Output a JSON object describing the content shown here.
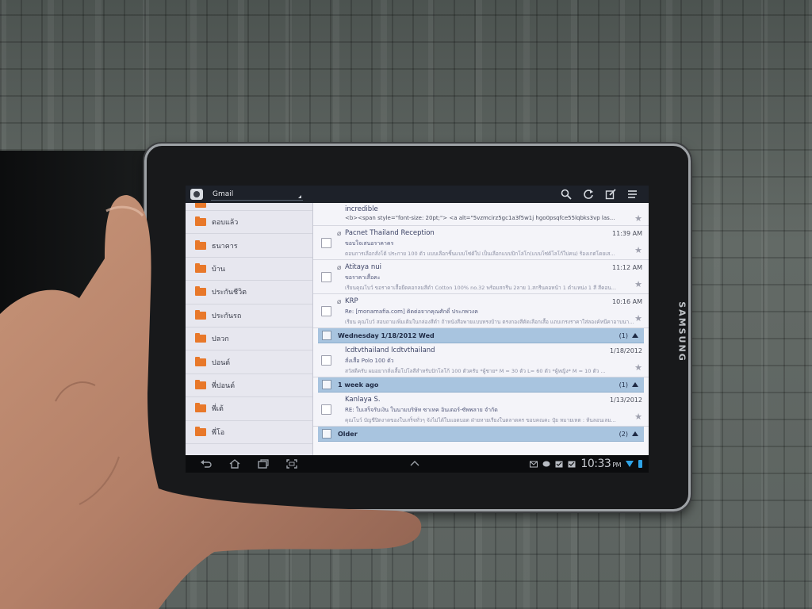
{
  "device": {
    "brand": "SAMSUNG"
  },
  "actionbar": {
    "account_label": "Gmail",
    "icons": [
      "search-icon",
      "refresh-icon",
      "compose-icon",
      "menu-icon"
    ]
  },
  "sidebar": {
    "items": [
      {
        "label": ""
      },
      {
        "label": "ตอบแล้ว"
      },
      {
        "label": "ธนาคาร"
      },
      {
        "label": "บ้าน"
      },
      {
        "label": "ประกันชีวิต"
      },
      {
        "label": "ประกันรถ"
      },
      {
        "label": "ปลวก"
      },
      {
        "label": "ปอนด์"
      },
      {
        "label": "พี่ปอนด์"
      },
      {
        "label": "พี่เต้"
      },
      {
        "label": "พี่โอ"
      }
    ]
  },
  "list": {
    "top_row": {
      "sender": "incredible",
      "snippet": "<b><span style=\"font-size: 20pt;\"> <a alt=\"5vzmcirz5gc1a3f5w1j hgo0psqfce55lqbks3vp las..."
    },
    "rows_today": [
      {
        "sender": "Pacnet Thailand Reception",
        "date": "11:39 AM",
        "subject": "ขอบใจเสนอราคาคร",
        "snippet": "ตอนการเลือกสั่งโต้ ประกาย 100 ตัว แบบเลือกชิ้นแบบโซ่ด้ใป เป็นเลือกแบบปิกโล่โก(แบบโซ่ด้โลโก้ใบ่คน) ร้องเกต่โดยเส..."
      },
      {
        "sender": "Atitaya nui",
        "date": "11:12 AM",
        "subject": "ขอราคาเสื้อคะ",
        "snippet": "เรียนคุณโบว์ ขอราคาเสื้อยืดคอกลมสีดำ Cotton 100% no.32 พร้อมสกรีน 2ลาย 1.สกรีนคอหน้า 1 ตำแหน่ง 1 สี สีคอน..."
      },
      {
        "sender": "KRP",
        "date": "10:16 AM",
        "subject": "Re: [monamafia.com] ติดต่อจากคุณศักดิ์ ประภพวงค",
        "snippet": "เรียน คุณโบว์ สอบถามเพิ่มเติมในกล่องสีดำ ถ้าหนังสือพายแบบทรงบ้าน ตรงกองสีตัดเลือกเสื้อ แถบเกรงราคาใส่ลองค์หนีคาอาบนา..."
      }
    ],
    "sections": [
      {
        "label": "Wednesday  1/18/2012 Wed",
        "count": "(1)"
      },
      {
        "label": "1 week ago",
        "count": "(1)"
      },
      {
        "label": "Older",
        "count": "(2)"
      }
    ],
    "row_wed": {
      "sender": "lcdtvthailand lcdtvthailand",
      "date": "1/18/2012",
      "subject": "สั่งเสื้อ Polo 100 ตัว",
      "snippet": "สวัสดีครับ ผมอยากสั่งเสื้อโปโลสีสำหรับปักโลโก้ 100 ตัวครับ *ผู้ชาย* M = 30 ตัว L= 60 ตัว *ผู้หญิง* M = 10 ตัว ..."
    },
    "row_week": {
      "sender": "Kanlaya S.",
      "date": "1/13/2012",
      "subject": "RE: ใบเสร็จรับเงิน ในนามบริษัท ซาเทค อินเตอร์-ซัพพลาย จำกัด",
      "snippet": "คุณโบว์ บัญชีปิดงาดของใบเสร็จทั่วๆ จังไม่ได้ใบแอดบอด ฝ่ายหายเรียงในตลาดคร ขอบคณคะ ปุ๋ย หมายเหต : ห้นลอนเลม..."
    }
  },
  "sysbar": {
    "clock": "10:33",
    "ampm": "PM"
  }
}
